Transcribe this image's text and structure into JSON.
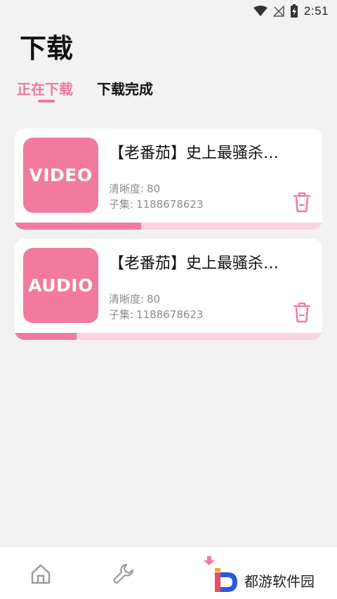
{
  "status_bar": {
    "time": "2:51",
    "icons": [
      "wifi-icon",
      "no-signal-icon",
      "battery-charging-icon"
    ]
  },
  "header": {
    "title": "下载"
  },
  "tabs": [
    {
      "label": "正在下载",
      "active": true
    },
    {
      "label": "下载完成",
      "active": false
    }
  ],
  "downloads": [
    {
      "thumb_label": "VIDEO",
      "title": "【老番茄】史上最骚杀…",
      "quality_label": "清晰度:",
      "quality_value": "80",
      "episode_label": "子集:",
      "episode_value": "1188678623",
      "progress": 0.41
    },
    {
      "thumb_label": "AUDIO",
      "title": "【老番茄】史上最骚杀…",
      "quality_label": "清晰度:",
      "quality_value": "80",
      "episode_label": "子集:",
      "episode_value": "1188678623",
      "progress": 0.2
    }
  ],
  "bottom_nav": {
    "items": [
      "home-icon",
      "wrench-icon",
      "download-icon"
    ],
    "watermark_text": "都游软件园"
  },
  "colors": {
    "accent": "#f07aa0",
    "accent_light": "#fcd3de",
    "thumb": "#f27a9f"
  }
}
